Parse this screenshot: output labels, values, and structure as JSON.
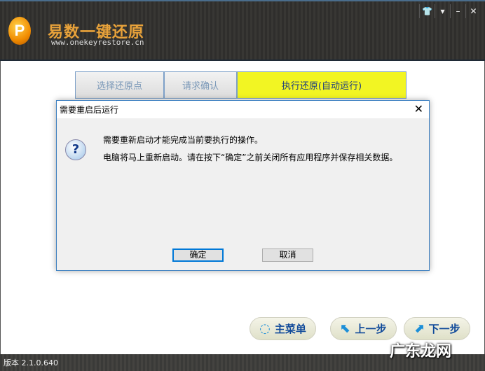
{
  "header": {
    "logo_text": "P",
    "brand": "易数一键还原",
    "url": "www.onekeyrestore.cn",
    "window_buttons": [
      "skin",
      "menu",
      "minimize",
      "close"
    ]
  },
  "steps": [
    {
      "label": "选择还原点"
    },
    {
      "label": "请求确认"
    },
    {
      "label": "执行还原(自动运行)"
    }
  ],
  "dialog": {
    "title": "需要重启后运行",
    "line1": "需要重新启动才能完成当前要执行的操作。",
    "line2": "电脑将马上重新启动。请在按下“确定”之前关闭所有应用程序并保存相关数据。",
    "ok": "确定",
    "cancel": "取消"
  },
  "nav": {
    "main_menu": "主菜单",
    "prev": "上一步",
    "next": "下一步"
  },
  "footer": {
    "version": "版本 2.1.0.640"
  },
  "watermark": "广东龙网"
}
